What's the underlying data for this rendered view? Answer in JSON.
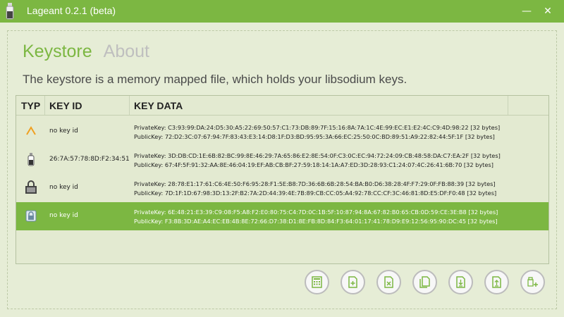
{
  "window": {
    "title": "Lageant 0.2.1 (beta)",
    "minimize_icon": "minimize-icon",
    "close_icon": "close-icon"
  },
  "tabs": [
    {
      "label": "Keystore",
      "active": true
    },
    {
      "label": "About",
      "active": false
    }
  ],
  "description": "The keystore is a memory mapped file, which holds your libsodium keys.",
  "table": {
    "columns": [
      "TYP",
      "KEY ID",
      "KEY DATA"
    ],
    "rows": [
      {
        "icon": "caret-up-icon",
        "key_id": "no key id",
        "selected": false,
        "private": "PrivateKey: C3:93:99:DA:24:D5:30:A5:22:69:50:57:C1:73:DB:89:7F:15:16:8A:7A:1C:4E:99:EC:E1:E2:4C:C9:4D:98:22 [32 bytes]",
        "public": "PublicKey: 72:D2:3C:07:67:94:7F:83:43:E3:14:D8:1F:D3:BD:95:95:3A:66:EC:25:50:0C:BD:89:51:A9:22:82:44:5F:1F [32 bytes]"
      },
      {
        "icon": "bottle-icon",
        "key_id": "26:7A:57:78:8D:F2:34:51",
        "selected": false,
        "private": "PrivateKey: 3D:DB:CD:1E:6B:82:BC:99:8E:46:29:7A:65:86:E2:8E:54:0F:C3:0C:EC:94:72:24:09:CB:48:58:DA:C7:EA:2F [32 bytes]",
        "public": "PublicKey: 67:4F:5F:91:32:AA:8E:46:04:19:EF:AB:CB:BF:27:59:18:14:1A:A7:ED:3D:28:93:C1:24:07:4C:26:41:6B:70 [32 bytes]"
      },
      {
        "icon": "lock-dark-icon",
        "key_id": "no key id",
        "selected": false,
        "private": "PrivateKey: 28:78:E1:17:61:C6:4E:50:F6:95:28:F1:5E:B8:7D:36:6B:6B:28:54:BA:B0:D6:38:28:4F:F7:29:0F:FB:88:39 [32 bytes]",
        "public": "PublicKey: 7D:1F:1D:67:98:3D:13:2F:B2:7A:2D:44:39:4E:7B:89:CB:CC:05:A4:92:78:CC:CF:3C:46:81:8D:E5:DF:F0:48 [32 bytes]"
      },
      {
        "icon": "lock-light-icon",
        "key_id": "no key id",
        "selected": true,
        "private": "PrivateKey: 6E:48:21:E3:39:C9:08:F5:A8:F2:E0:80:75:C4:7D:0C:1B:5F:10:87:94:8A:67:82:B0:65:CB:0D:59:CE:3E:B8 [32 bytes]",
        "public": "PublicKey: F3:8B:3D:AE:A4:EC:EB:4B:8E:72:66:D7:38:D1:8E:FB:8D:84:F3:64:01:17:41:78:D9:E9:12:56:95:90:DC:45 [32 bytes]"
      }
    ]
  },
  "toolbar": [
    {
      "name": "calculator-button",
      "icon": "calculator-icon"
    },
    {
      "name": "add-document-button",
      "icon": "add-document-icon"
    },
    {
      "name": "delete-document-button",
      "icon": "delete-document-icon"
    },
    {
      "name": "copy-document-button",
      "icon": "copy-document-icon"
    },
    {
      "name": "import-button",
      "icon": "import-icon"
    },
    {
      "name": "export-button",
      "icon": "export-icon"
    },
    {
      "name": "add-key-button",
      "icon": "add-key-icon"
    }
  ],
  "colors": {
    "accent": "#7cb742",
    "background": "#e6edd6",
    "tab_inactive": "#bfbfbf"
  }
}
